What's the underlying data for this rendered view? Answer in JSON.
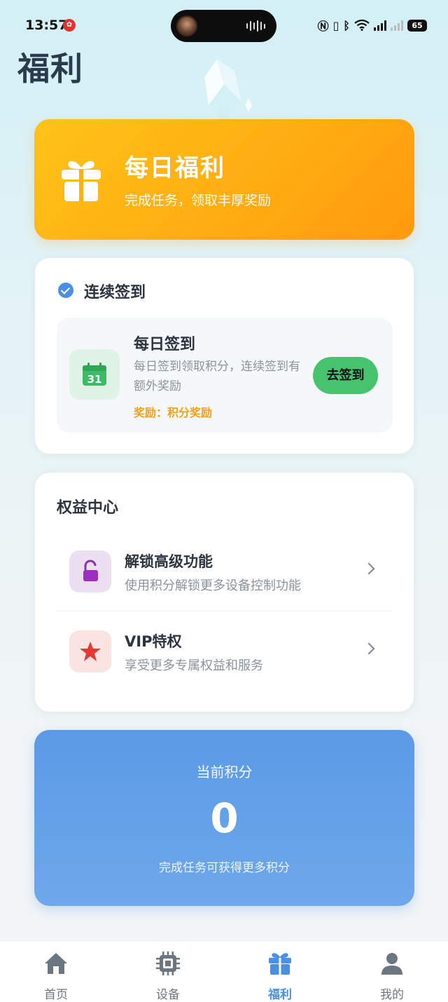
{
  "status_bar": {
    "time": "13:57",
    "battery": "65",
    "network": "5G"
  },
  "page": {
    "title": "福利"
  },
  "banner": {
    "title": "每日福利",
    "subtitle": "完成任务，领取丰厚奖励",
    "icon": "gift-icon",
    "colors": {
      "from": "#ffc21a",
      "to": "#ff9a0e"
    }
  },
  "checkin": {
    "section_title": "连续签到",
    "item_title": "每日签到",
    "item_desc": "每日签到领取积分，连续签到有额外奖励",
    "reward": "奖励：积分奖励",
    "button_label": "去签到",
    "calendar_day": "31",
    "colors": {
      "button": "#47c26e",
      "reward": "#f4a01a"
    }
  },
  "rights": {
    "section_title": "权益中心",
    "items": [
      {
        "title": "解锁高级功能",
        "desc": "使用积分解锁更多设备控制功能",
        "icon": "lock-icon"
      },
      {
        "title": "VIP特权",
        "desc": "享受更多专属权益和服务",
        "icon": "star-icon"
      }
    ]
  },
  "points": {
    "label": "当前积分",
    "value": "0",
    "hint": "完成任务可获得更多积分",
    "color": "#5a9ae6"
  },
  "nav": {
    "items": [
      {
        "label": "首页",
        "icon": "home-icon"
      },
      {
        "label": "设备",
        "icon": "chip-icon"
      },
      {
        "label": "福利",
        "icon": "gift-icon",
        "active": true
      },
      {
        "label": "我的",
        "icon": "user-icon"
      }
    ],
    "active_color": "#4a90e2"
  }
}
